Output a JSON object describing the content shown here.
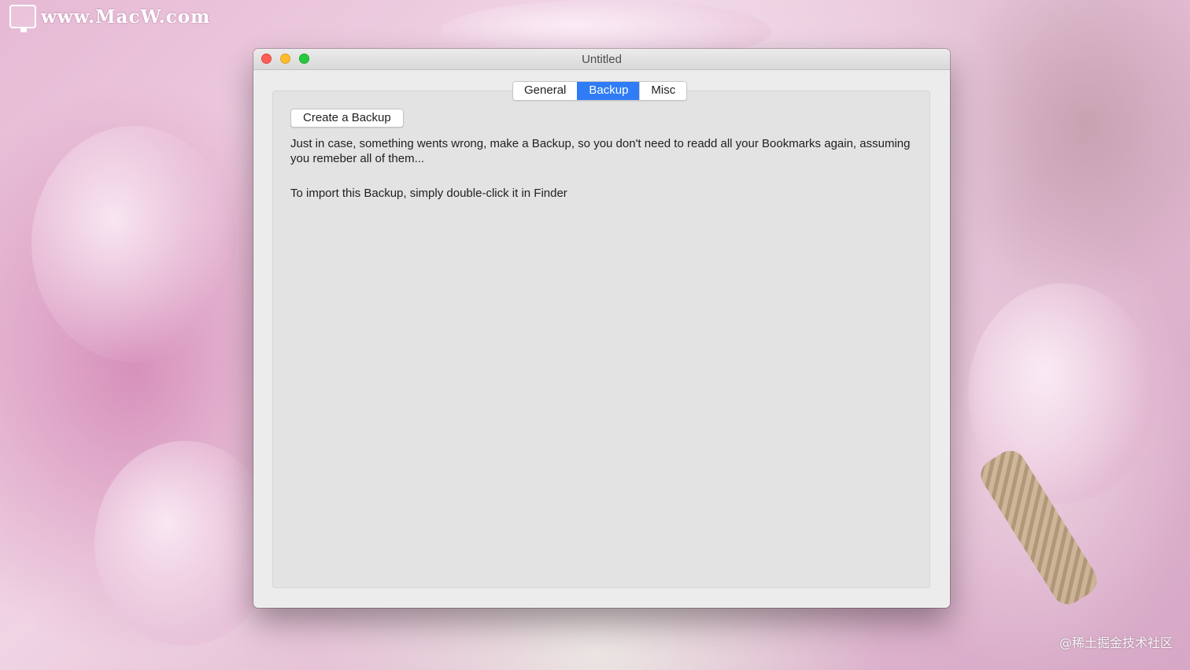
{
  "desktop": {
    "watermark_text": "www.MacW.com",
    "credit_text": "@稀土掘金技术社区"
  },
  "window": {
    "title": "Untitled",
    "tabs": [
      {
        "label": "General",
        "active": false
      },
      {
        "label": "Backup",
        "active": true
      },
      {
        "label": "Misc",
        "active": false
      }
    ],
    "backup": {
      "button_label": "Create a Backup",
      "description": "Just in case, something wents wrong, make a Backup, so you don't need to readd all your Bookmarks again, assuming you remeber all of them...",
      "import_hint": "To import this Backup, simply double-click it in Finder"
    }
  },
  "colors": {
    "accent": "#2f7cf6",
    "close": "#fe5f57",
    "minimize": "#febc2e",
    "maximize": "#28c840"
  }
}
